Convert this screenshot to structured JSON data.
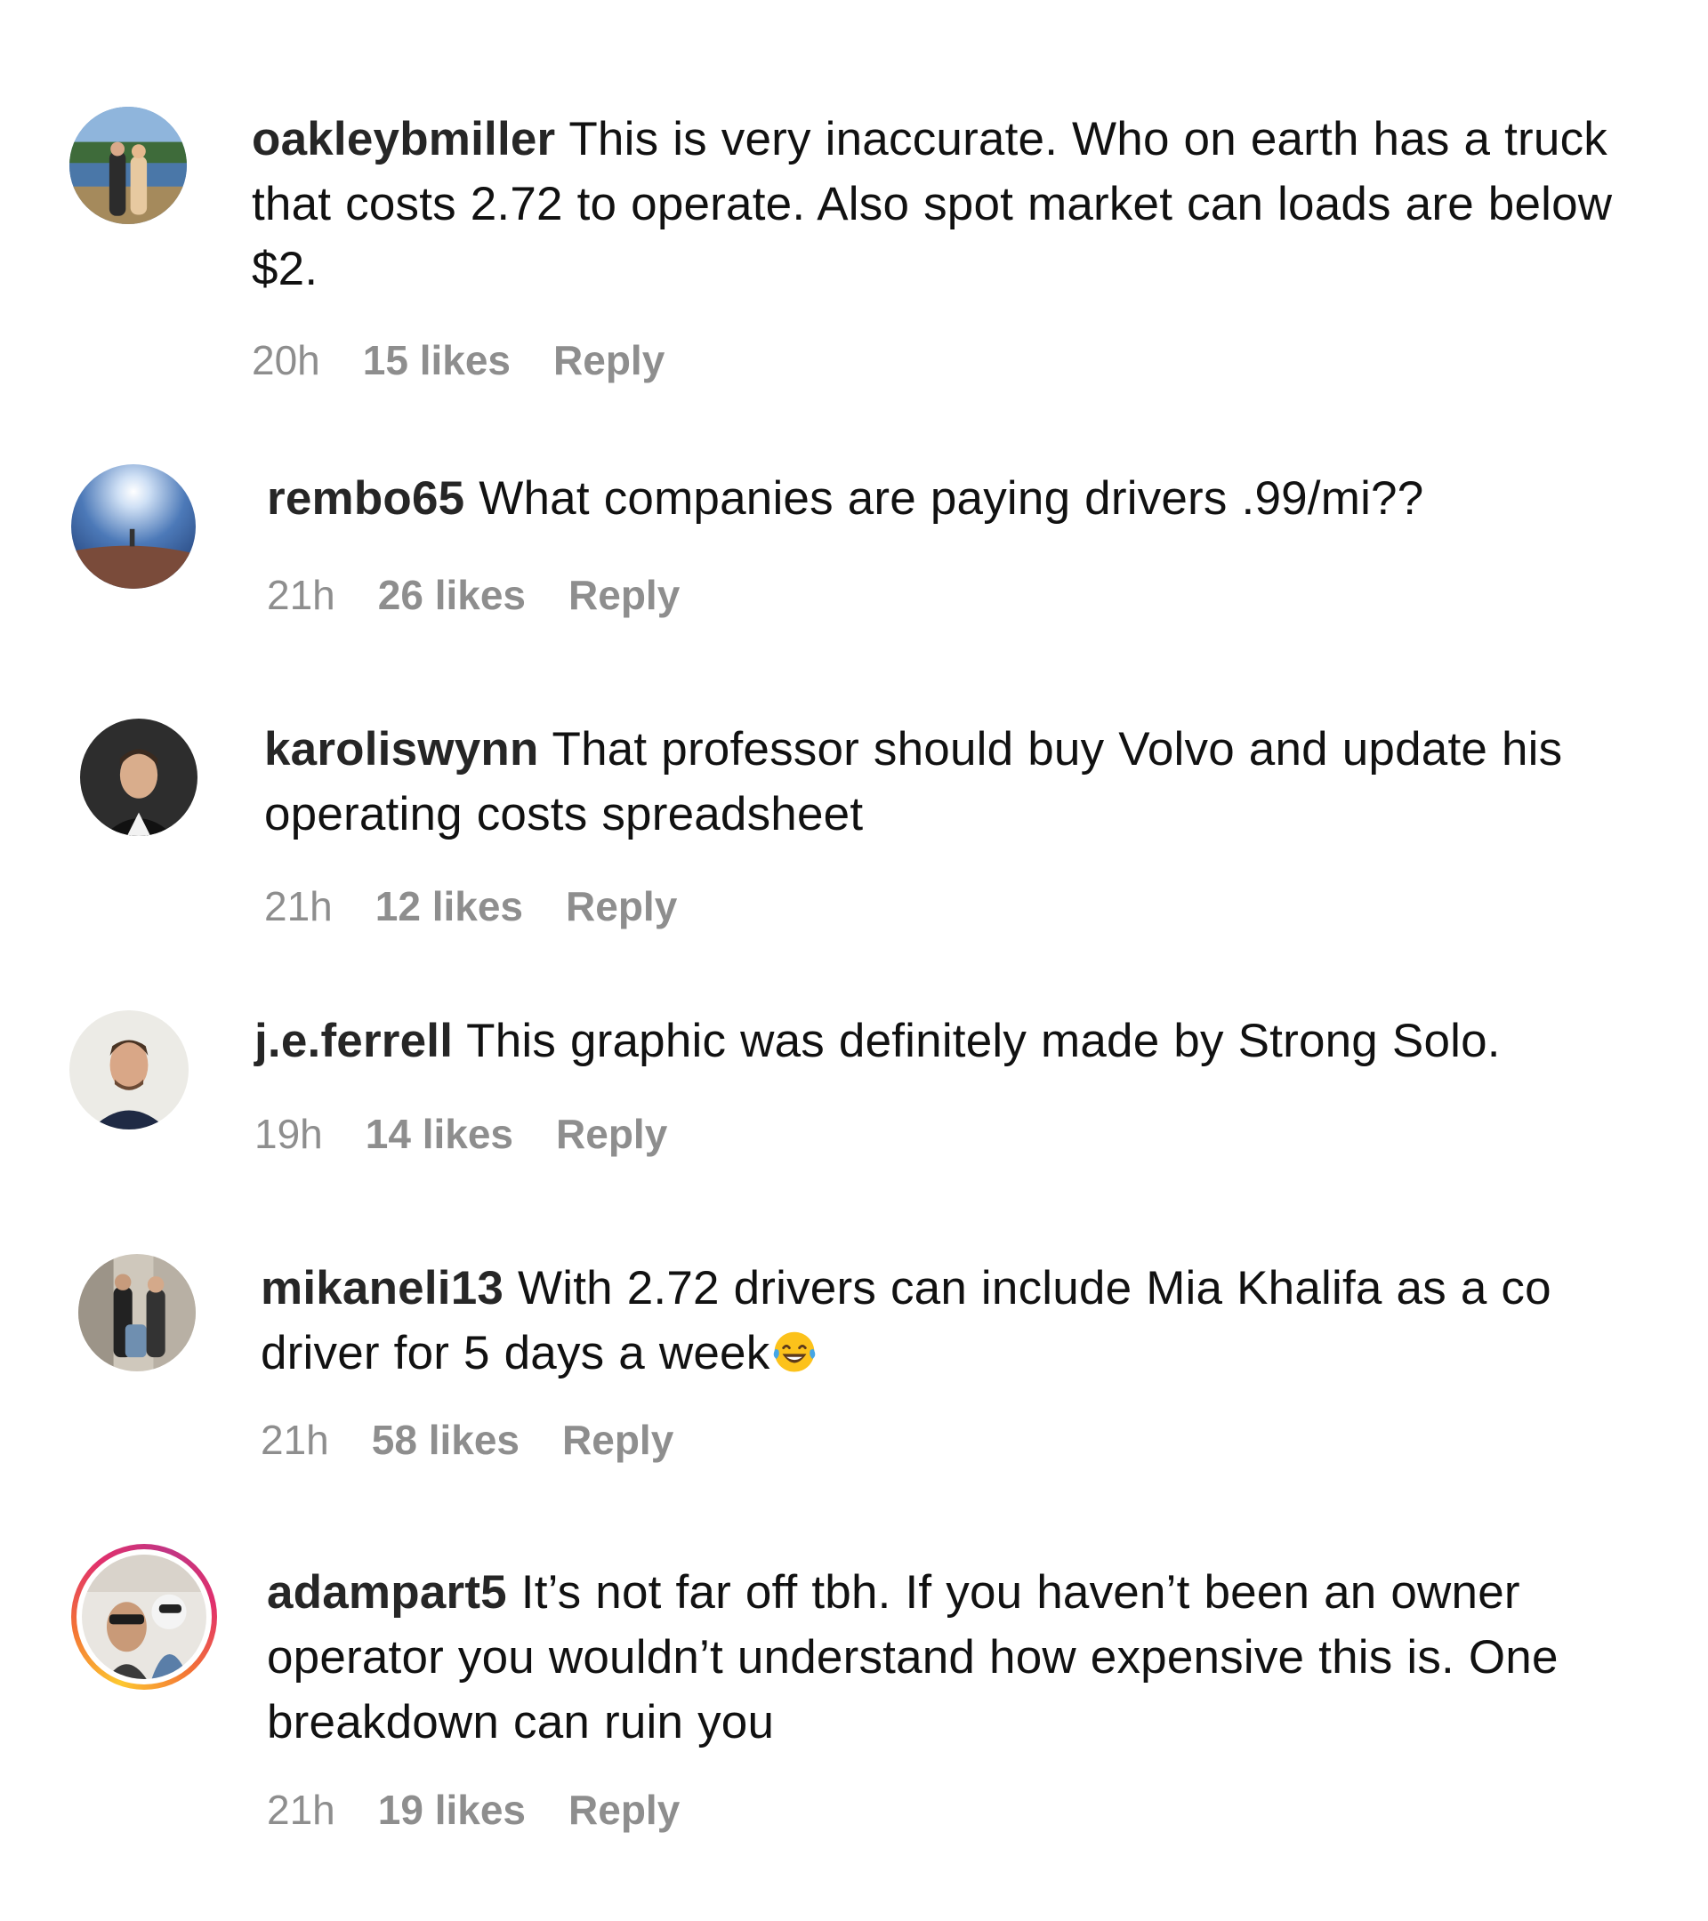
{
  "comments": [
    {
      "username": "oakleybmiller",
      "text": "This is very inaccurate. Who on earth has a truck that costs 2.72 to operate. Also spot market can loads are below $2.",
      "time": "20h",
      "likes": "15 likes",
      "reply": "Reply"
    },
    {
      "username": "rembo65",
      "text": "What companies are paying drivers .99/mi??",
      "time": "21h",
      "likes": "26 likes",
      "reply": "Reply"
    },
    {
      "username": "karoliswynn",
      "text": "That professor should buy Volvo and update his operating costs spreadsheet",
      "time": "21h",
      "likes": "12 likes",
      "reply": "Reply"
    },
    {
      "username": "j.e.ferrell",
      "text": "This graphic was definitely made by Strong Solo.",
      "time": "19h",
      "likes": "14 likes",
      "reply": "Reply"
    },
    {
      "username": "mikaneli13",
      "text": "With 2.72 drivers can include Mia Khalifa as a co driver for 5 days a week",
      "emoji": "face-with-tears-of-joy-icon",
      "time": "21h",
      "likes": "58 likes",
      "reply": "Reply"
    },
    {
      "username": "adampart5",
      "text": "It’s not far off tbh. If you haven’t been an owner operator you wouldn’t understand how expensive this is. One breakdown can ruin you",
      "time": "21h",
      "likes": "19 likes",
      "reply": "Reply",
      "story_ring": true
    }
  ]
}
